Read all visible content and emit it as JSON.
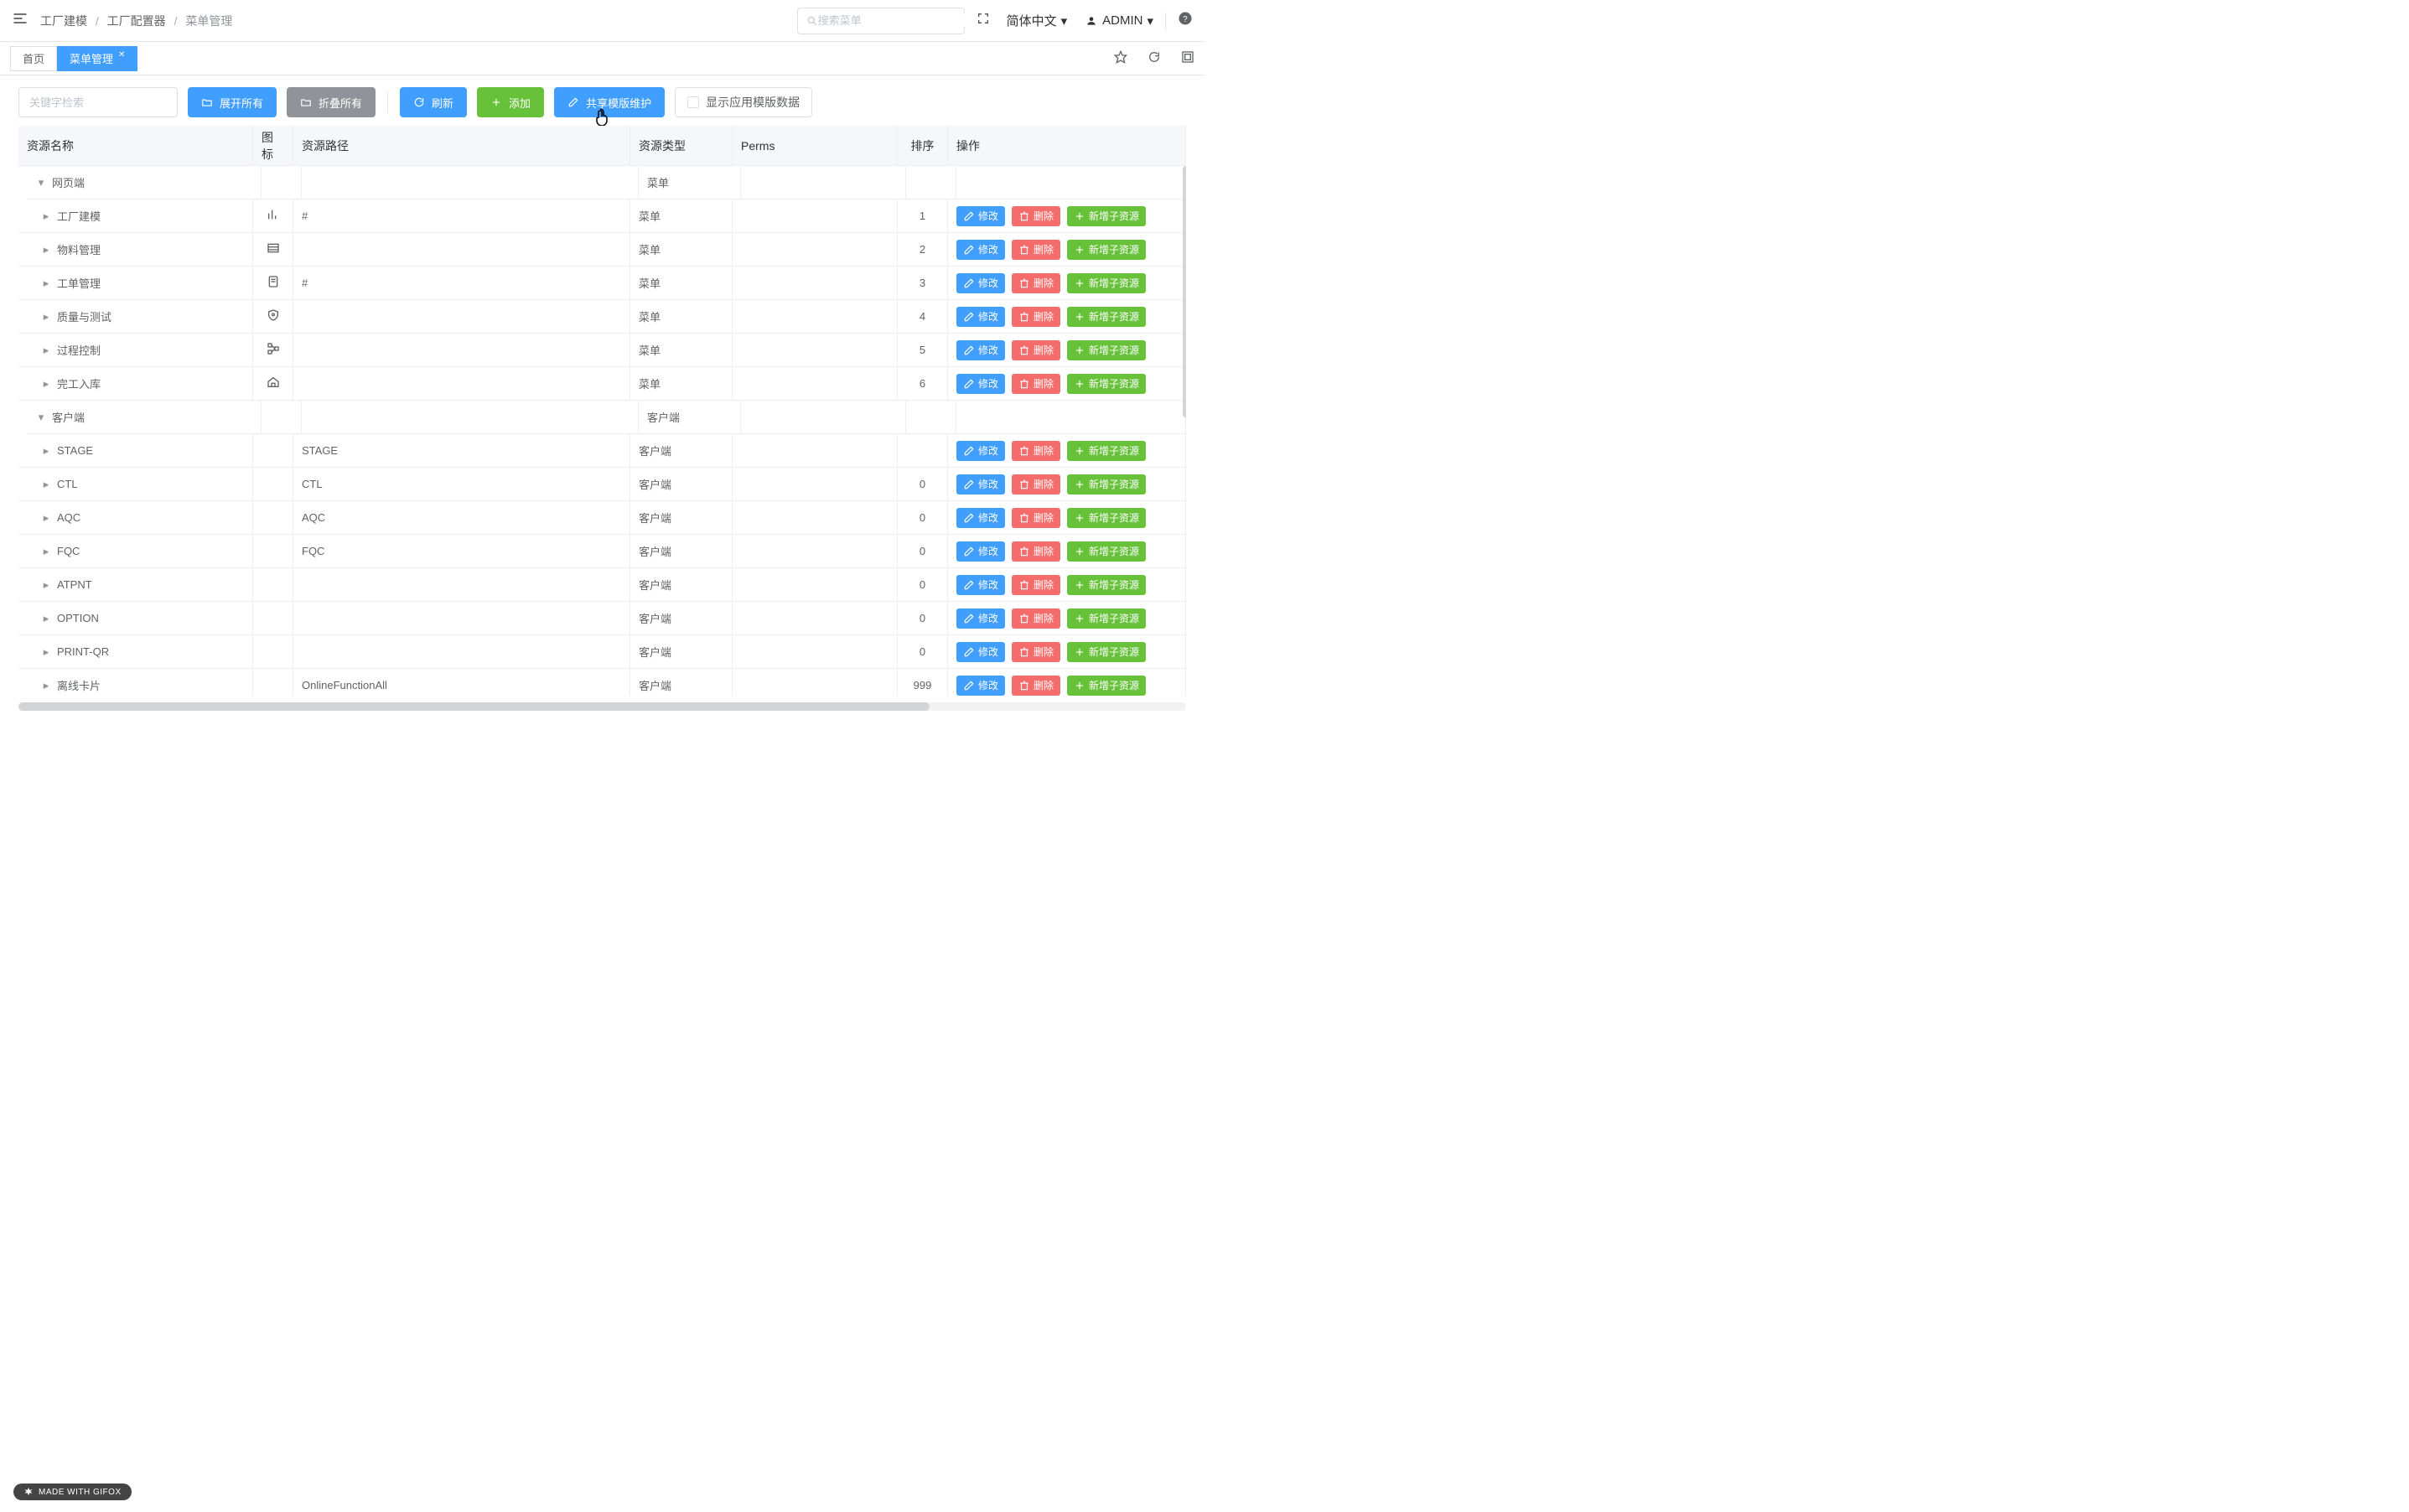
{
  "header": {
    "breadcrumb": [
      "工厂建模",
      "工厂配置器",
      "菜单管理"
    ],
    "search_placeholder": "搜索菜单",
    "language": "简体中文",
    "user": "ADMIN"
  },
  "tabs": {
    "home": "首页",
    "active": "菜单管理"
  },
  "toolbar": {
    "keyword_placeholder": "关键字检索",
    "expand_all": "展开所有",
    "collapse_all": "折叠所有",
    "refresh": "刷新",
    "add": "添加",
    "share_template": "共享模版维护",
    "show_app_template_data": "显示应用模版数据"
  },
  "table": {
    "headers": {
      "name": "资源名称",
      "icon": "图标",
      "path": "资源路径",
      "type": "资源类型",
      "perms": "Perms",
      "sort": "排序",
      "action": "操作"
    },
    "actions": {
      "edit": "修改",
      "delete": "删除",
      "add_child": "新增子资源"
    },
    "rows": [
      {
        "level": 0,
        "expanded": true,
        "name": "网页端",
        "icon": "",
        "path": "",
        "type": "菜单",
        "perms": "",
        "sort": "",
        "has_action": false
      },
      {
        "level": 1,
        "expanded": false,
        "name": "工厂建模",
        "icon": "bar",
        "path": "#",
        "type": "菜单",
        "perms": "",
        "sort": "1",
        "has_action": true
      },
      {
        "level": 1,
        "expanded": false,
        "name": "物料管理",
        "icon": "table",
        "path": "",
        "type": "菜单",
        "perms": "",
        "sort": "2",
        "has_action": true
      },
      {
        "level": 1,
        "expanded": false,
        "name": "工单管理",
        "icon": "doc",
        "path": "#",
        "type": "菜单",
        "perms": "",
        "sort": "3",
        "has_action": true
      },
      {
        "level": 1,
        "expanded": false,
        "name": "质量与测试",
        "icon": "shield",
        "path": "",
        "type": "菜单",
        "perms": "",
        "sort": "4",
        "has_action": true
      },
      {
        "level": 1,
        "expanded": false,
        "name": "过程控制",
        "icon": "flow",
        "path": "",
        "type": "菜单",
        "perms": "",
        "sort": "5",
        "has_action": true
      },
      {
        "level": 1,
        "expanded": false,
        "name": "完工入库",
        "icon": "house",
        "path": "",
        "type": "菜单",
        "perms": "",
        "sort": "6",
        "has_action": true
      },
      {
        "level": 0,
        "expanded": true,
        "name": "客户端",
        "icon": "",
        "path": "",
        "type": "客户端",
        "perms": "",
        "sort": "",
        "has_action": false
      },
      {
        "level": 1,
        "expanded": false,
        "name": "STAGE",
        "icon": "",
        "path": "STAGE",
        "type": "客户端",
        "perms": "",
        "sort": "",
        "has_action": true
      },
      {
        "level": 1,
        "expanded": false,
        "name": "CTL",
        "icon": "",
        "path": "CTL",
        "type": "客户端",
        "perms": "",
        "sort": "0",
        "has_action": true
      },
      {
        "level": 1,
        "expanded": false,
        "name": "AQC",
        "icon": "",
        "path": "AQC",
        "type": "客户端",
        "perms": "",
        "sort": "0",
        "has_action": true
      },
      {
        "level": 1,
        "expanded": false,
        "name": "FQC",
        "icon": "",
        "path": "FQC",
        "type": "客户端",
        "perms": "",
        "sort": "0",
        "has_action": true
      },
      {
        "level": 1,
        "expanded": false,
        "name": "ATPNT",
        "icon": "",
        "path": "",
        "type": "客户端",
        "perms": "",
        "sort": "0",
        "has_action": true
      },
      {
        "level": 1,
        "expanded": false,
        "name": "OPTION",
        "icon": "",
        "path": "",
        "type": "客户端",
        "perms": "",
        "sort": "0",
        "has_action": true
      },
      {
        "level": 1,
        "expanded": false,
        "name": "PRINT-QR",
        "icon": "",
        "path": "",
        "type": "客户端",
        "perms": "",
        "sort": "0",
        "has_action": true
      },
      {
        "level": 1,
        "expanded": false,
        "name": "离线卡片",
        "icon": "",
        "path": "OnlineFunctionAll",
        "type": "客户端",
        "perms": "",
        "sort": "999",
        "has_action": true
      }
    ]
  },
  "badge": {
    "gifox": "MADE WITH GIFOX"
  }
}
